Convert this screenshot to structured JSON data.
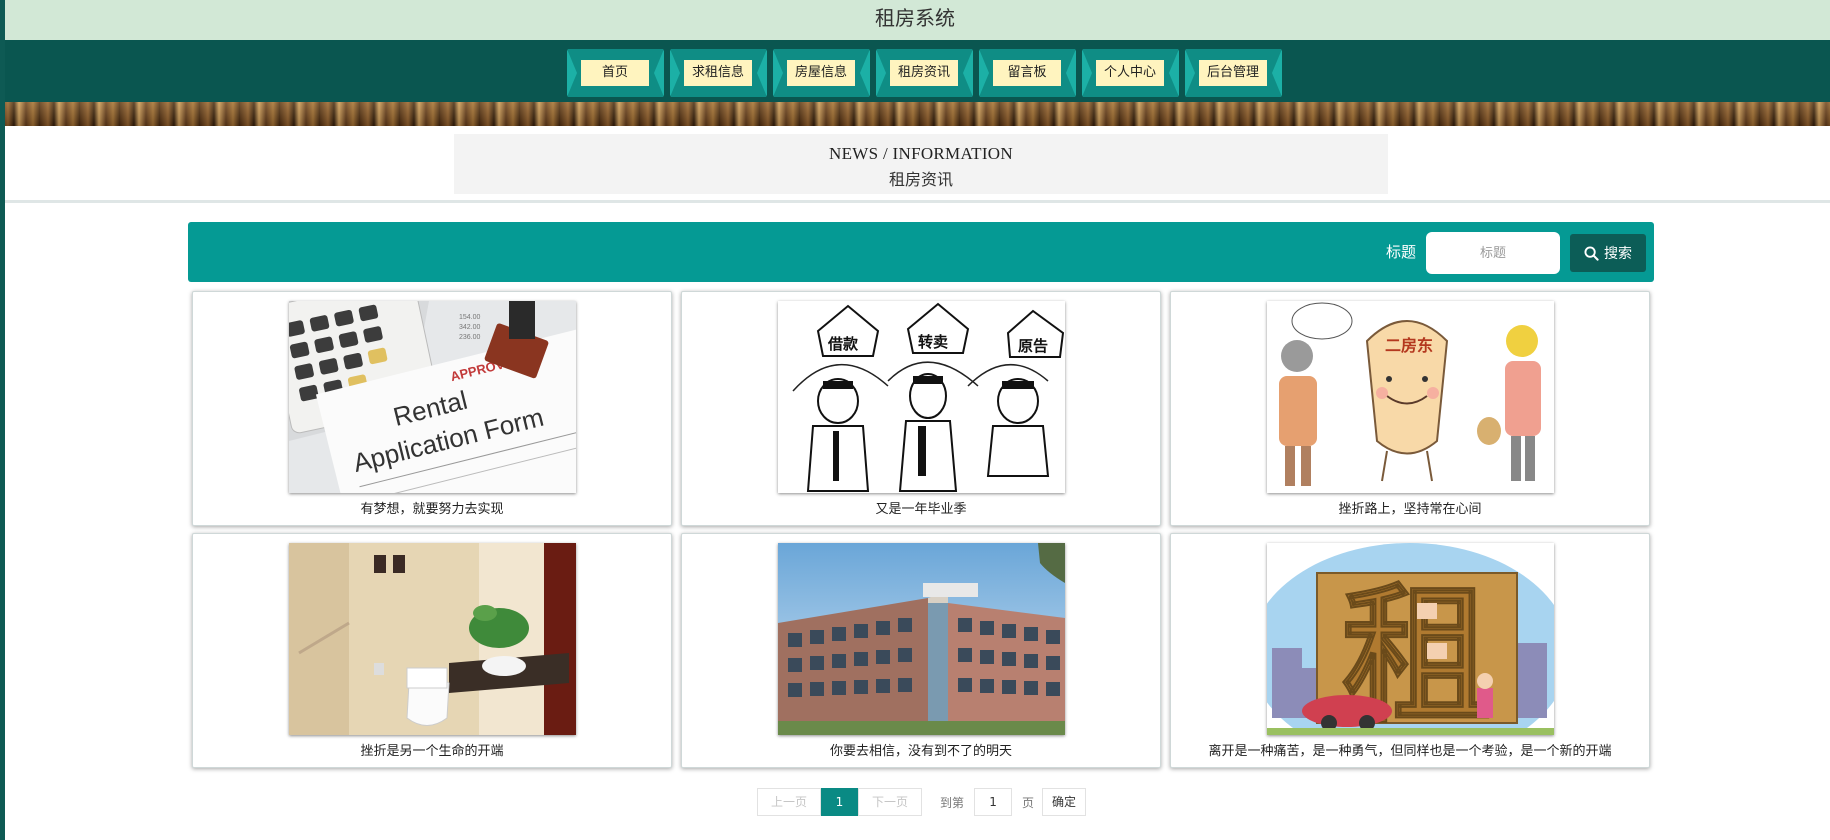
{
  "app": {
    "title": "租房系统"
  },
  "nav": {
    "items": [
      {
        "label": "首页"
      },
      {
        "label": "求租信息"
      },
      {
        "label": "房屋信息"
      },
      {
        "label": "租房资讯"
      },
      {
        "label": "留言板"
      },
      {
        "label": "个人中心"
      },
      {
        "label": "后台管理"
      }
    ]
  },
  "section": {
    "title_en": "NEWS / INFORMATION",
    "title_cn": "租房资讯"
  },
  "search": {
    "label": "标题",
    "placeholder": "标题",
    "button_label": "搜索",
    "accent_color": "#059a94"
  },
  "news": [
    {
      "caption": "有梦想，就要努力去实现",
      "image": "rental-application-form-photo",
      "image_text_1": "Rental",
      "image_text_2": "Application Form",
      "image_text_3": "APPROVED"
    },
    {
      "caption": "又是一年毕业季",
      "image": "cartoon-three-men-houses",
      "image_text_1": "借款",
      "image_text_2": "转卖",
      "image_text_3": "原告"
    },
    {
      "caption": "挫折路上，坚持常在心间",
      "image": "cartoon-sublandlord",
      "image_text_1": "二房东"
    },
    {
      "caption": "挫折是另一个生命的开端",
      "image": "bathroom-photo"
    },
    {
      "caption": "你要去相信，没有到不了的明天",
      "image": "office-building-render"
    },
    {
      "caption": "离开是一种痛苦，是一种勇气，但同样也是一个考验，是一个新的开端",
      "image": "cartoon-rent-character",
      "image_text_1": "租"
    }
  ],
  "pagination": {
    "prev_label": "上一页",
    "current_page": "1",
    "next_label": "下一页",
    "goto_prefix": "到第",
    "goto_value": "1",
    "goto_suffix": "页",
    "confirm_label": "确定"
  }
}
